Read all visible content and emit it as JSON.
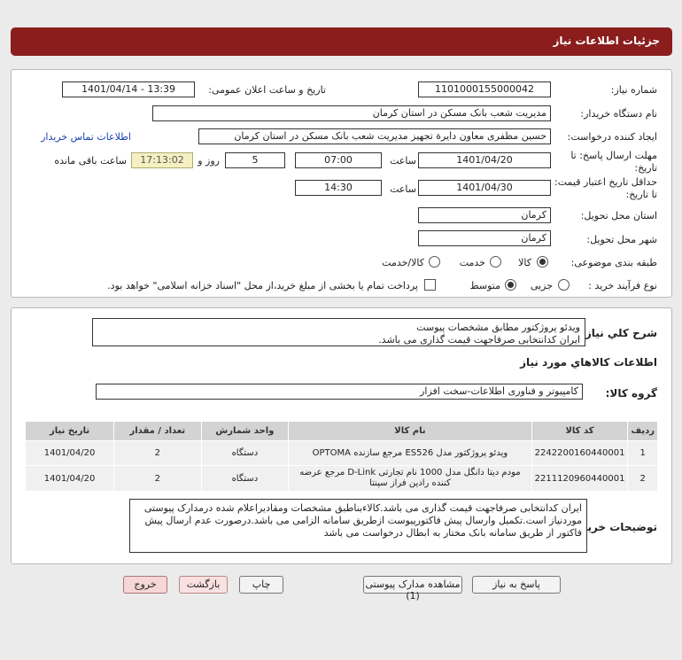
{
  "title": "جزئیات اطلاعات نیاز",
  "form": {
    "need_number_label": "شماره نیاز:",
    "need_number": "1101000155000042",
    "announce_label": "تاریخ و ساعت اعلان عمومی:",
    "announce_value": "1401/04/14 - 13:39",
    "buyer_org_label": "نام دستگاه خریدار:",
    "buyer_org": "مدیریت شعب بانک مسکن در استان کرمان",
    "creator_label": "ایجاد کننده درخواست:",
    "creator": "حسین  مظفری  معاون دایرة تجهیز مدیریت شعب بانک مسکن در استان کرمان",
    "contact_link": "اطلاعات تماس خریدار",
    "deadline_label": "مهلت ارسال پاسخ: تا تاریخ:",
    "deadline_date": "1401/04/20",
    "time_word": "ساعت",
    "deadline_time": "07:00",
    "days": "5",
    "days_and": "روز و",
    "remaining": "17:13:02",
    "remaining_label": "ساعت باقی مانده",
    "validity_label": "حداقل تاریخ اعتبار قیمت: تا تاریخ:",
    "validity_date": "1401/04/30",
    "validity_time": "14:30",
    "province_label": "استان محل تحویل:",
    "province": "کرمان",
    "city_label": "شهر محل تحویل:",
    "city": "کرمان",
    "category_label": "طبقه بندی موضوعی:",
    "category_options": [
      "کالا",
      "خدمت",
      "کالا/خدمت"
    ],
    "process_label": "نوع فرآیند خرید :",
    "process_options": [
      "جزیی",
      "متوسط"
    ],
    "payment_note": "پرداخت تمام یا بخشی از مبلغ خرید،از محل \"اسناد خزانه اسلامی\" خواهد بود."
  },
  "summary": {
    "label": "شرح کلي نياز:",
    "line1": "ویدئو پروژکتور مطابق مشخصات پیوست",
    "line2": "ایران کدانتخابی صرفاجهت قیمت گذاری می باشد."
  },
  "goods_title": "اطلاعات کالاهاي مورد نياز",
  "goods_group_label": "گروه کالا:",
  "goods_group": "کامپیوتر و فناوری اطلاعات-سخت افزار",
  "table": {
    "headers": [
      "ردیف",
      "کد کالا",
      "نام کالا",
      "واحد شمارش",
      "تعداد / مقدار",
      "تاریخ نیاز"
    ],
    "rows": [
      [
        "1",
        "2242200160440001",
        "ویدئو پروژکتور مدل ES526 مرجع سازنده OPTOMA",
        "دستگاه",
        "2",
        "1401/04/20"
      ],
      [
        "2",
        "2211120960440001",
        "مودم دیتا دانگل مدل 1000 نام تجارتی D-Link مرجع عرضه کننده رادین فراز سپنتا",
        "دستگاه",
        "2",
        "1401/04/20"
      ]
    ]
  },
  "buyer_notes_label": "توضیحات خریدار:",
  "buyer_notes": "ایران کدانتخابی صرفاجهت قیمت گذاری می باشد.کالاءبناطبق مشخصات ومقادیراعلام شده درمدارک پیوستی موردنیاز است.تکمیل وارسال پیش فاکتورپیوست ازطریق سامانه الزامی می باشد.درصورت عدم ارسال پیش فاکتور از طریق سامانه بانک مختار به ابطال درخواست می باشد",
  "buttons": {
    "reply": "پاسخ به نیاز",
    "view_docs": "مشاهده مدارک پیوستی (1)",
    "print": "چاپ",
    "back": "بازگشت",
    "exit": "خروج"
  }
}
